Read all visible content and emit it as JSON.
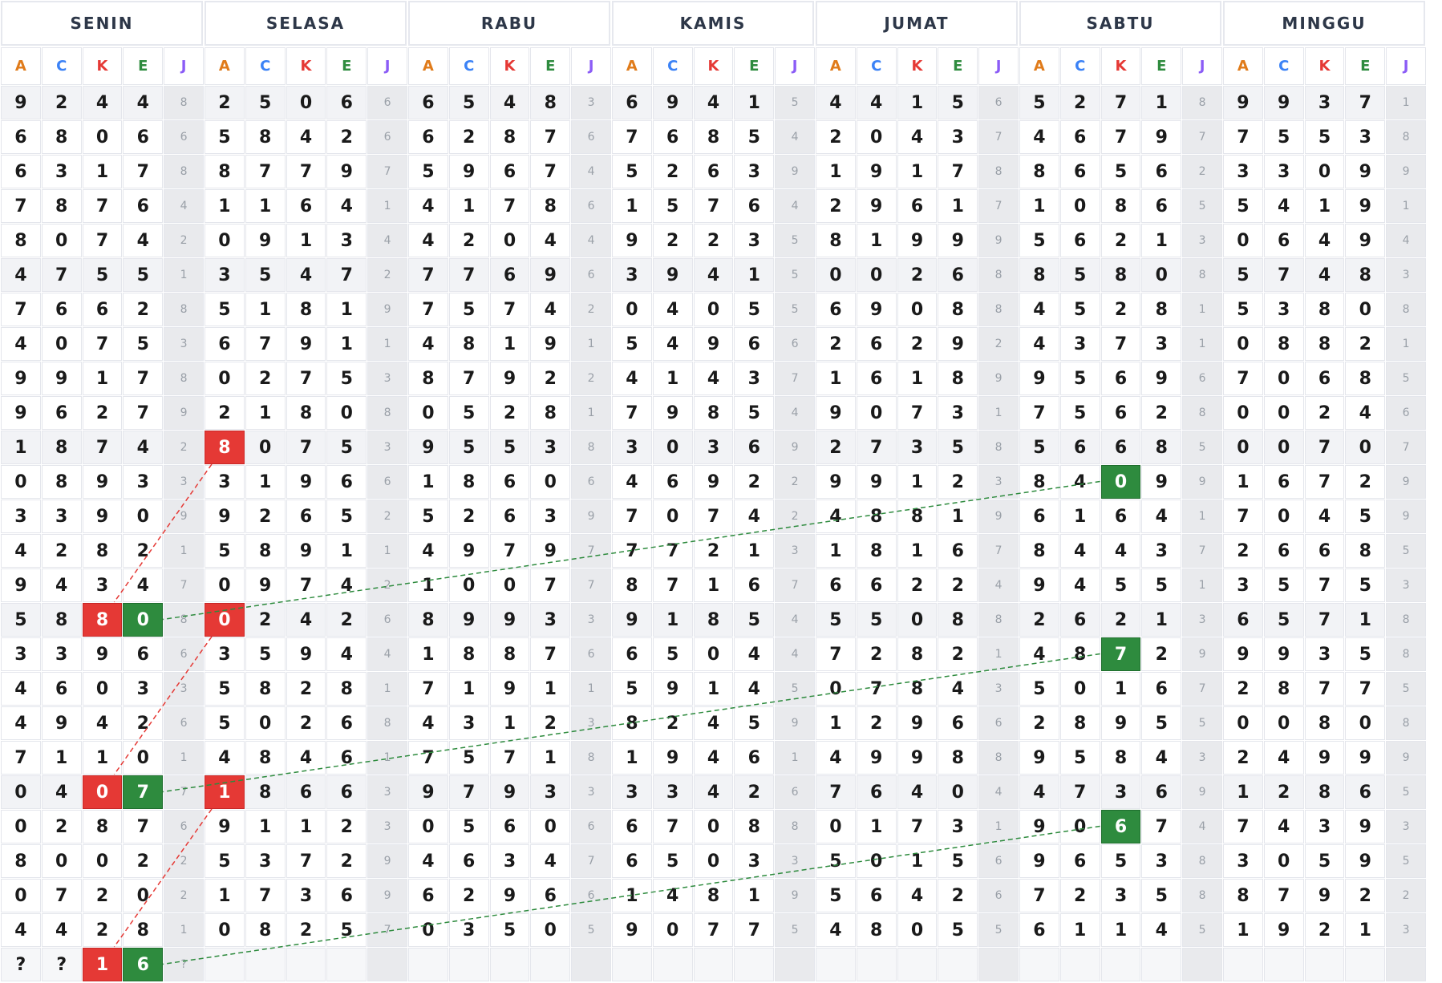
{
  "days": [
    "SENIN",
    "SELASA",
    "RABU",
    "KAMIS",
    "JUMAT",
    "SABTU",
    "MINGGU"
  ],
  "sub_labels": [
    "A",
    "C",
    "K",
    "E",
    "J"
  ],
  "sub_colors": [
    "#e07b1a",
    "#3b82f6",
    "#e53935",
    "#2e8b3e",
    "#8b5cf6"
  ],
  "rows": [
    [
      [
        9,
        2,
        4,
        4,
        8
      ],
      [
        2,
        5,
        0,
        6,
        6
      ],
      [
        6,
        5,
        4,
        8,
        3
      ],
      [
        6,
        9,
        4,
        1,
        5
      ],
      [
        4,
        4,
        1,
        5,
        6
      ],
      [
        5,
        2,
        7,
        1,
        8
      ],
      [
        9,
        9,
        3,
        7,
        1
      ]
    ],
    [
      [
        6,
        8,
        0,
        6,
        6
      ],
      [
        5,
        8,
        4,
        2,
        6
      ],
      [
        6,
        2,
        8,
        7,
        6
      ],
      [
        7,
        6,
        8,
        5,
        4
      ],
      [
        2,
        0,
        4,
        3,
        7
      ],
      [
        4,
        6,
        7,
        9,
        7
      ],
      [
        7,
        5,
        5,
        3,
        8
      ]
    ],
    [
      [
        6,
        3,
        1,
        7,
        8
      ],
      [
        8,
        7,
        7,
        9,
        7
      ],
      [
        5,
        9,
        6,
        7,
        4
      ],
      [
        5,
        2,
        6,
        3,
        9
      ],
      [
        1,
        9,
        1,
        7,
        8
      ],
      [
        8,
        6,
        5,
        6,
        2
      ],
      [
        3,
        3,
        0,
        9,
        9
      ]
    ],
    [
      [
        7,
        8,
        7,
        6,
        4
      ],
      [
        1,
        1,
        6,
        4,
        1
      ],
      [
        4,
        1,
        7,
        8,
        6
      ],
      [
        1,
        5,
        7,
        6,
        4
      ],
      [
        2,
        9,
        6,
        1,
        7
      ],
      [
        1,
        0,
        8,
        6,
        5
      ],
      [
        5,
        4,
        1,
        9,
        1
      ]
    ],
    [
      [
        8,
        0,
        7,
        4,
        2
      ],
      [
        0,
        9,
        1,
        3,
        4
      ],
      [
        4,
        2,
        0,
        4,
        4
      ],
      [
        9,
        2,
        2,
        3,
        5
      ],
      [
        8,
        1,
        9,
        9,
        9
      ],
      [
        5,
        6,
        2,
        1,
        3
      ],
      [
        0,
        6,
        4,
        9,
        4
      ]
    ],
    [
      [
        4,
        7,
        5,
        5,
        1
      ],
      [
        3,
        5,
        4,
        7,
        2
      ],
      [
        7,
        7,
        6,
        9,
        6
      ],
      [
        3,
        9,
        4,
        1,
        5
      ],
      [
        0,
        0,
        2,
        6,
        8
      ],
      [
        8,
        5,
        8,
        0,
        8
      ],
      [
        5,
        7,
        4,
        8,
        3
      ]
    ],
    [
      [
        7,
        6,
        6,
        2,
        8
      ],
      [
        5,
        1,
        8,
        1,
        9
      ],
      [
        7,
        5,
        7,
        4,
        2
      ],
      [
        0,
        4,
        0,
        5,
        5
      ],
      [
        6,
        9,
        0,
        8,
        8
      ],
      [
        4,
        5,
        2,
        8,
        1
      ],
      [
        5,
        3,
        8,
        0,
        8
      ]
    ],
    [
      [
        4,
        0,
        7,
        5,
        3
      ],
      [
        6,
        7,
        9,
        1,
        1
      ],
      [
        4,
        8,
        1,
        9,
        1
      ],
      [
        5,
        4,
        9,
        6,
        6
      ],
      [
        2,
        6,
        2,
        9,
        2
      ],
      [
        4,
        3,
        7,
        3,
        1
      ],
      [
        0,
        8,
        8,
        2,
        1
      ]
    ],
    [
      [
        9,
        9,
        1,
        7,
        8
      ],
      [
        0,
        2,
        7,
        5,
        3
      ],
      [
        8,
        7,
        9,
        2,
        2
      ],
      [
        4,
        1,
        4,
        3,
        7
      ],
      [
        1,
        6,
        1,
        8,
        9
      ],
      [
        9,
        5,
        6,
        9,
        6
      ],
      [
        7,
        0,
        6,
        8,
        5
      ]
    ],
    [
      [
        9,
        6,
        2,
        7,
        9
      ],
      [
        2,
        1,
        8,
        0,
        8
      ],
      [
        0,
        5,
        2,
        8,
        1
      ],
      [
        7,
        9,
        8,
        5,
        4
      ],
      [
        9,
        0,
        7,
        3,
        1
      ],
      [
        7,
        5,
        6,
        2,
        8
      ],
      [
        0,
        0,
        2,
        4,
        6
      ]
    ],
    [
      [
        1,
        8,
        7,
        4,
        2
      ],
      [
        8,
        0,
        7,
        5,
        3
      ],
      [
        9,
        5,
        5,
        3,
        8
      ],
      [
        3,
        0,
        3,
        6,
        9
      ],
      [
        2,
        7,
        3,
        5,
        8
      ],
      [
        5,
        6,
        6,
        8,
        5
      ],
      [
        0,
        0,
        7,
        0,
        7
      ]
    ],
    [
      [
        0,
        8,
        9,
        3,
        3
      ],
      [
        3,
        1,
        9,
        6,
        6
      ],
      [
        1,
        8,
        6,
        0,
        6
      ],
      [
        4,
        6,
        9,
        2,
        2
      ],
      [
        9,
        9,
        1,
        2,
        3
      ],
      [
        8,
        4,
        0,
        9,
        9
      ],
      [
        1,
        6,
        7,
        2,
        9
      ]
    ],
    [
      [
        3,
        3,
        9,
        0,
        9
      ],
      [
        9,
        2,
        6,
        5,
        2
      ],
      [
        5,
        2,
        6,
        3,
        9
      ],
      [
        7,
        0,
        7,
        4,
        2
      ],
      [
        4,
        8,
        8,
        1,
        9
      ],
      [
        6,
        1,
        6,
        4,
        1
      ],
      [
        7,
        0,
        4,
        5,
        9
      ]
    ],
    [
      [
        4,
        2,
        8,
        2,
        1
      ],
      [
        5,
        8,
        9,
        1,
        1
      ],
      [
        4,
        9,
        7,
        9,
        7
      ],
      [
        7,
        7,
        2,
        1,
        3
      ],
      [
        1,
        8,
        1,
        6,
        7
      ],
      [
        8,
        4,
        4,
        3,
        7
      ],
      [
        2,
        6,
        6,
        8,
        5
      ]
    ],
    [
      [
        9,
        4,
        3,
        4,
        7
      ],
      [
        0,
        9,
        7,
        4,
        2
      ],
      [
        1,
        0,
        0,
        7,
        7
      ],
      [
        8,
        7,
        1,
        6,
        7
      ],
      [
        6,
        6,
        2,
        2,
        4
      ],
      [
        9,
        4,
        5,
        5,
        1
      ],
      [
        3,
        5,
        7,
        5,
        3
      ]
    ],
    [
      [
        5,
        8,
        8,
        0,
        8
      ],
      [
        0,
        2,
        4,
        2,
        6
      ],
      [
        8,
        9,
        9,
        3,
        3
      ],
      [
        9,
        1,
        8,
        5,
        4
      ],
      [
        5,
        5,
        0,
        8,
        8
      ],
      [
        2,
        6,
        2,
        1,
        3
      ],
      [
        6,
        5,
        7,
        1,
        8
      ]
    ],
    [
      [
        3,
        3,
        9,
        6,
        6
      ],
      [
        3,
        5,
        9,
        4,
        4
      ],
      [
        1,
        8,
        8,
        7,
        6
      ],
      [
        6,
        5,
        0,
        4,
        4
      ],
      [
        7,
        2,
        8,
        2,
        1
      ],
      [
        4,
        8,
        7,
        2,
        9
      ],
      [
        9,
        9,
        3,
        5,
        8
      ]
    ],
    [
      [
        4,
        6,
        0,
        3,
        3
      ],
      [
        5,
        8,
        2,
        8,
        1
      ],
      [
        7,
        1,
        9,
        1,
        1
      ],
      [
        5,
        9,
        1,
        4,
        5
      ],
      [
        0,
        7,
        8,
        4,
        3
      ],
      [
        5,
        0,
        1,
        6,
        7
      ],
      [
        2,
        8,
        7,
        7,
        5
      ]
    ],
    [
      [
        4,
        9,
        4,
        2,
        6
      ],
      [
        5,
        0,
        2,
        6,
        8
      ],
      [
        4,
        3,
        1,
        2,
        3
      ],
      [
        8,
        2,
        4,
        5,
        9
      ],
      [
        1,
        2,
        9,
        6,
        6
      ],
      [
        2,
        8,
        9,
        5,
        5
      ],
      [
        0,
        0,
        8,
        0,
        8
      ]
    ],
    [
      [
        7,
        1,
        1,
        0,
        1
      ],
      [
        4,
        8,
        4,
        6,
        1
      ],
      [
        7,
        5,
        7,
        1,
        8
      ],
      [
        1,
        9,
        4,
        6,
        1
      ],
      [
        4,
        9,
        9,
        8,
        8
      ],
      [
        9,
        5,
        8,
        4,
        3
      ],
      [
        2,
        4,
        9,
        9,
        9
      ]
    ],
    [
      [
        0,
        4,
        0,
        7,
        7
      ],
      [
        1,
        8,
        6,
        6,
        3
      ],
      [
        9,
        7,
        9,
        3,
        3
      ],
      [
        3,
        3,
        4,
        2,
        6
      ],
      [
        7,
        6,
        4,
        0,
        4
      ],
      [
        4,
        7,
        3,
        6,
        9
      ],
      [
        1,
        2,
        8,
        6,
        5
      ]
    ],
    [
      [
        0,
        2,
        8,
        7,
        6
      ],
      [
        9,
        1,
        1,
        2,
        3
      ],
      [
        0,
        5,
        6,
        0,
        6
      ],
      [
        6,
        7,
        0,
        8,
        8
      ],
      [
        0,
        1,
        7,
        3,
        1
      ],
      [
        9,
        0,
        6,
        7,
        4
      ],
      [
        7,
        4,
        3,
        9,
        3
      ]
    ],
    [
      [
        8,
        0,
        0,
        2,
        2
      ],
      [
        5,
        3,
        7,
        2,
        9
      ],
      [
        4,
        6,
        3,
        4,
        7
      ],
      [
        6,
        5,
        0,
        3,
        3
      ],
      [
        5,
        0,
        1,
        5,
        6
      ],
      [
        9,
        6,
        5,
        3,
        8
      ],
      [
        3,
        0,
        5,
        9,
        5
      ]
    ],
    [
      [
        0,
        7,
        2,
        0,
        2
      ],
      [
        1,
        7,
        3,
        6,
        9
      ],
      [
        6,
        2,
        9,
        6,
        6
      ],
      [
        1,
        4,
        8,
        1,
        9
      ],
      [
        5,
        6,
        4,
        2,
        6
      ],
      [
        7,
        2,
        3,
        5,
        8
      ],
      [
        8,
        7,
        9,
        2,
        2
      ]
    ],
    [
      [
        4,
        4,
        2,
        8,
        1
      ],
      [
        0,
        8,
        2,
        5,
        7
      ],
      [
        0,
        3,
        5,
        0,
        5
      ],
      [
        9,
        0,
        7,
        7,
        5
      ],
      [
        4,
        8,
        0,
        5,
        5
      ],
      [
        6,
        1,
        1,
        4,
        5
      ],
      [
        1,
        9,
        2,
        1,
        3
      ]
    ]
  ],
  "last_row": [
    "?",
    "?",
    "1",
    "6",
    "?"
  ],
  "highlights": [
    {
      "row": 10,
      "day": 1,
      "col": 0,
      "color": "red"
    },
    {
      "row": 11,
      "day": 5,
      "col": 2,
      "color": "green"
    },
    {
      "row": 15,
      "day": 0,
      "col": 2,
      "color": "red"
    },
    {
      "row": 15,
      "day": 0,
      "col": 3,
      "color": "green"
    },
    {
      "row": 15,
      "day": 1,
      "col": 0,
      "color": "red"
    },
    {
      "row": 16,
      "day": 5,
      "col": 2,
      "color": "green"
    },
    {
      "row": 20,
      "day": 0,
      "col": 2,
      "color": "red"
    },
    {
      "row": 20,
      "day": 0,
      "col": 3,
      "color": "green"
    },
    {
      "row": 20,
      "day": 1,
      "col": 0,
      "color": "red"
    },
    {
      "row": 21,
      "day": 5,
      "col": 2,
      "color": "green"
    },
    {
      "row": 25,
      "day": 0,
      "col": 2,
      "color": "red"
    },
    {
      "row": 25,
      "day": 0,
      "col": 3,
      "color": "green"
    }
  ],
  "connectors": [
    {
      "color": "red",
      "from": {
        "row": 10,
        "day": 1,
        "col": 0
      },
      "to": {
        "row": 15,
        "day": 0,
        "col": 2
      }
    },
    {
      "color": "red",
      "from": {
        "row": 15,
        "day": 1,
        "col": 0
      },
      "to": {
        "row": 20,
        "day": 0,
        "col": 2
      }
    },
    {
      "color": "red",
      "from": {
        "row": 20,
        "day": 1,
        "col": 0
      },
      "to": {
        "row": 25,
        "day": 0,
        "col": 2
      }
    },
    {
      "color": "green",
      "from": {
        "row": 11,
        "day": 5,
        "col": 2
      },
      "to": {
        "row": 15,
        "day": 0,
        "col": 3
      }
    },
    {
      "color": "green",
      "from": {
        "row": 16,
        "day": 5,
        "col": 2
      },
      "to": {
        "row": 20,
        "day": 0,
        "col": 3
      }
    },
    {
      "color": "green",
      "from": {
        "row": 21,
        "day": 5,
        "col": 2
      },
      "to": {
        "row": 25,
        "day": 0,
        "col": 3
      }
    }
  ],
  "colors": {
    "red": "#e53935",
    "green": "#2e8b3e",
    "red_line": "#e53935",
    "green_line": "#2e8b3e"
  }
}
